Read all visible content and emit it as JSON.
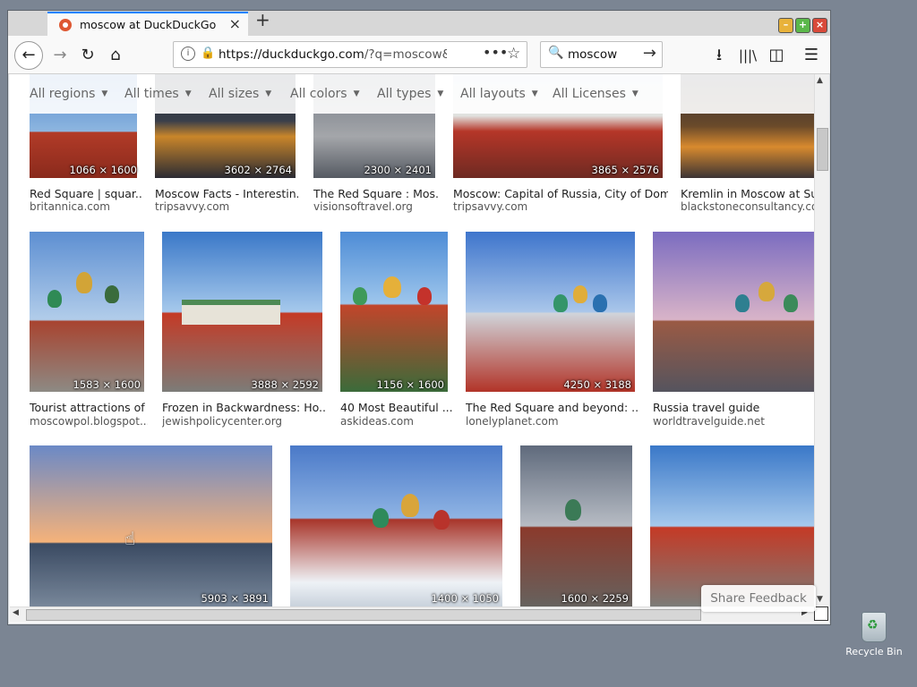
{
  "browser": {
    "tab_title": "moscow at DuckDuckGo",
    "url_host": "https://duckduckgo.com",
    "url_rest": "/?q=moscow&",
    "search_query": "moscow",
    "menu_glyph": "☰"
  },
  "filters": [
    "All regions",
    "All times",
    "All sizes",
    "All colors",
    "All types",
    "All layouts",
    "All Licenses"
  ],
  "rows": [
    [
      {
        "caption": "Red Square | squar...",
        "source": "britannica.com",
        "dims": "1066 × 1600"
      },
      {
        "caption": "Moscow Facts - Interestin...",
        "source": "tripsavvy.com",
        "dims": "3602 × 2764"
      },
      {
        "caption": "The Red Square : Mos...",
        "source": "visionsoftravel.org",
        "dims": "2300 × 2401"
      },
      {
        "caption": "Moscow: Capital of Russia, City of Domes",
        "source": "tripsavvy.com",
        "dims": "3865 × 2576"
      },
      {
        "caption": "Kremlin in Moscow at Suns",
        "source": "blackstoneconsultancy.com",
        "dims": ""
      }
    ],
    [
      {
        "caption": "Tourist attractions of ...",
        "source": "moscowpol.blogspot....",
        "dims": "1583 × 1600"
      },
      {
        "caption": "Frozen in Backwardness: Ho...",
        "source": "jewishpolicycenter.org",
        "dims": "3888 × 2592"
      },
      {
        "caption": "40 Most Beautiful ...",
        "source": "askideas.com",
        "dims": "1156 × 1600"
      },
      {
        "caption": "The Red Square and beyond: ...",
        "source": "lonelyplanet.com",
        "dims": "4250 × 3188"
      },
      {
        "caption": "Russia travel guide",
        "source": "worldtravelguide.net",
        "dims": ""
      }
    ],
    [
      {
        "caption": "",
        "source": "",
        "dims": "5903 × 3891"
      },
      {
        "caption": "",
        "source": "",
        "dims": "1400 × 1050"
      },
      {
        "caption": "",
        "source": "",
        "dims": "1600 × 2259"
      },
      {
        "caption": "",
        "source": "",
        "dims": ""
      }
    ]
  ],
  "feedback_label": "Share Feedback",
  "desktop": {
    "recycle_label": "Recycle Bin"
  }
}
